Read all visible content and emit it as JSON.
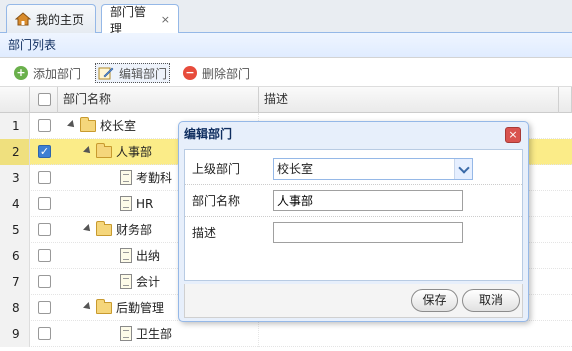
{
  "tabs": [
    {
      "label": "我的主页",
      "icon": "home-icon"
    },
    {
      "label": "部门管理",
      "close": "×"
    }
  ],
  "panel": {
    "title": "部门列表"
  },
  "toolbar": {
    "add_label": "添加部门",
    "edit_label": "编辑部门",
    "delete_label": "删除部门"
  },
  "grid": {
    "columns": [
      "部门名称",
      "描述"
    ],
    "rows": [
      {
        "num": "1",
        "name": "校长室",
        "type": "folder",
        "level": 0,
        "checked": false
      },
      {
        "num": "2",
        "name": "人事部",
        "type": "folder",
        "level": 1,
        "checked": true
      },
      {
        "num": "3",
        "name": "考勤科",
        "type": "file",
        "level": 2,
        "checked": false
      },
      {
        "num": "4",
        "name": "HR",
        "type": "file",
        "level": 2,
        "checked": false
      },
      {
        "num": "5",
        "name": "财务部",
        "type": "folder",
        "level": 1,
        "checked": false
      },
      {
        "num": "6",
        "name": "出纳",
        "type": "file",
        "level": 2,
        "checked": false
      },
      {
        "num": "7",
        "name": "会计",
        "type": "file",
        "level": 2,
        "checked": false
      },
      {
        "num": "8",
        "name": "后勤管理",
        "type": "folder",
        "level": 1,
        "checked": false
      },
      {
        "num": "9",
        "name": "卫生部",
        "type": "file",
        "level": 2,
        "checked": false
      }
    ]
  },
  "dialog": {
    "title": "编辑部门",
    "close": "×",
    "parent_label": "上级部门",
    "parent_value": "校长室",
    "name_label": "部门名称",
    "name_value": "人事部",
    "desc_label": "描述",
    "desc_value": "",
    "save_label": "保存",
    "cancel_label": "取消"
  },
  "colors": {
    "selected_row": "#fbec88",
    "border_blue": "#95b8e7",
    "checkbox_checked": "#3e7fd3",
    "close_red": "#d9534f"
  }
}
